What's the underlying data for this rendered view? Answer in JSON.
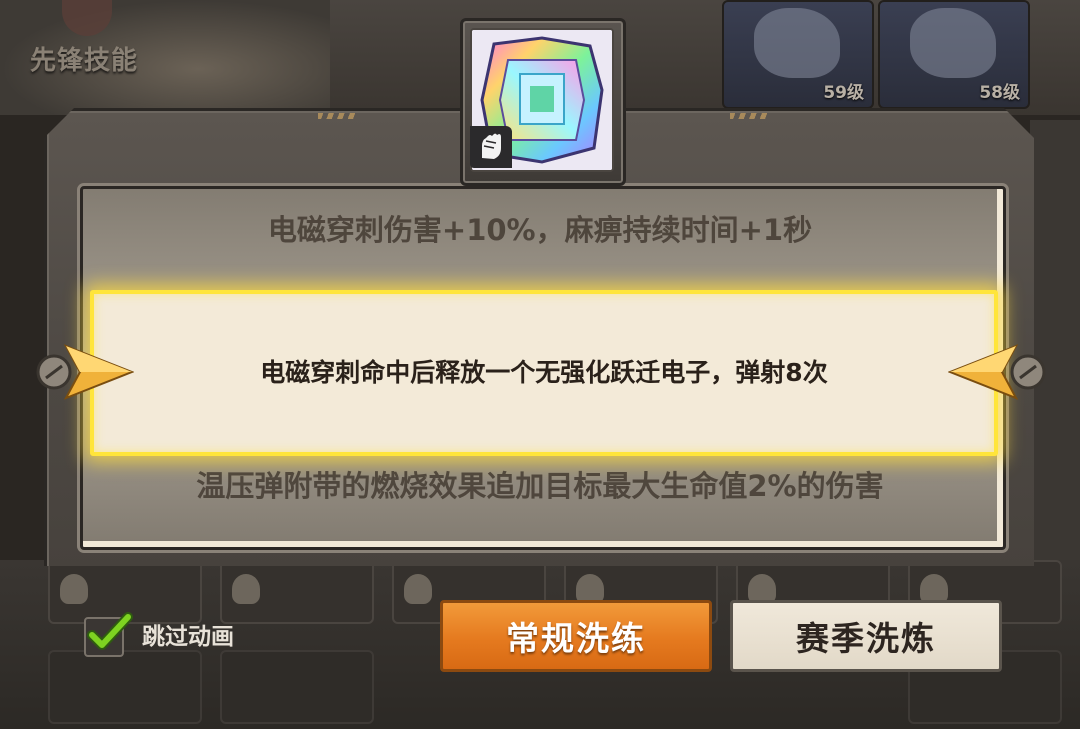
{
  "background": {
    "section_title": "先锋技能",
    "cards": [
      {
        "level": "59级"
      },
      {
        "level": "58级"
      }
    ]
  },
  "dialog": {
    "options": [
      {
        "text": "电磁穿刺伤害+10%，麻痹持续时间+1秒",
        "state": "faded"
      },
      {
        "text": "电磁穿刺命中后释放一个无强化跃迁电子，弹射8次",
        "state": "selected"
      },
      {
        "text": "温压弹附带的燃烧效果追加目标最大生命值2%的伤害",
        "state": "faded"
      }
    ]
  },
  "item": {
    "icon": "rainbow-gem-icon",
    "badge_icon": "glove-icon"
  },
  "controls": {
    "skip_animation_label": "跳过动画",
    "skip_animation_checked": true,
    "normal_reroll_label": "常规洗练",
    "season_reroll_label": "赛季洗炼"
  },
  "colors": {
    "highlight": "#ffe53a",
    "primary_button": "#e57a1f",
    "secondary_button": "#e9e1d1",
    "checkmark": "#7ed321"
  }
}
